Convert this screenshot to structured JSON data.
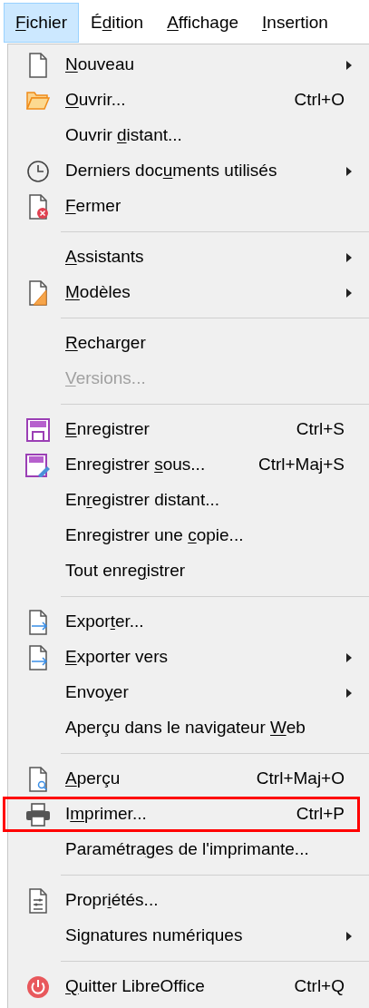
{
  "menubar": [
    {
      "key": "F",
      "after": "ichier",
      "selected": true
    },
    {
      "before": "É",
      "key": "d",
      "after": "ition",
      "selected": false
    },
    {
      "key": "A",
      "after": "ffichage",
      "selected": false
    },
    {
      "key": "I",
      "after": "nsertion",
      "selected": false
    }
  ],
  "menu": [
    {
      "kind": "item",
      "key": "N",
      "after": "ouveau",
      "submenu": true
    },
    {
      "kind": "item",
      "key": "O",
      "after": "uvrir...",
      "shortcut": "Ctrl+O"
    },
    {
      "kind": "item",
      "before": "Ouvrir ",
      "key": "d",
      "after": "istant..."
    },
    {
      "kind": "item",
      "before": "Derniers doc",
      "key": "u",
      "after": "ments utilisés",
      "submenu": true
    },
    {
      "kind": "item",
      "key": "F",
      "after": "ermer"
    },
    {
      "kind": "separator"
    },
    {
      "kind": "item",
      "key": "A",
      "after": "ssistants",
      "submenu": true
    },
    {
      "kind": "item",
      "key": "M",
      "after": "odèles",
      "submenu": true
    },
    {
      "kind": "separator"
    },
    {
      "kind": "item",
      "key": "R",
      "after": "echarger"
    },
    {
      "kind": "item",
      "key": "V",
      "after": "ersions...",
      "disabled": true
    },
    {
      "kind": "separator"
    },
    {
      "kind": "item",
      "key": "E",
      "after": "nregistrer",
      "shortcut": "Ctrl+S"
    },
    {
      "kind": "item",
      "before": "Enregistrer ",
      "key": "s",
      "after": "ous...",
      "shortcut": "Ctrl+Maj+S"
    },
    {
      "kind": "item",
      "before": "En",
      "key": "r",
      "after": "egistrer distant..."
    },
    {
      "kind": "item",
      "before": "Enregistrer une ",
      "key": "c",
      "after": "opie..."
    },
    {
      "kind": "item",
      "before": "Tout enre",
      "key": "g",
      "after": "istrer"
    },
    {
      "kind": "separator"
    },
    {
      "kind": "item",
      "before": "Expor",
      "key": "t",
      "after": "er..."
    },
    {
      "kind": "item",
      "key": "E",
      "after": "xporter vers",
      "submenu": true
    },
    {
      "kind": "item",
      "before": "Envo",
      "key": "y",
      "after": "er",
      "submenu": true
    },
    {
      "kind": "item",
      "before": "Aperçu dans le navigateur ",
      "key": "W",
      "after": "eb"
    },
    {
      "kind": "separator"
    },
    {
      "kind": "item",
      "key": "A",
      "after": "perçu",
      "shortcut": "Ctrl+Maj+O"
    },
    {
      "kind": "item",
      "before": "I",
      "key": "m",
      "after": "primer...",
      "shortcut": "Ctrl+P",
      "highlighted": true
    },
    {
      "kind": "item",
      "before": "Paramétra",
      "key": "g",
      "after": "es de l'imprimante..."
    },
    {
      "kind": "separator"
    },
    {
      "kind": "item",
      "before": "Propr",
      "key": "i",
      "after": "étés..."
    },
    {
      "kind": "item",
      "before": "Signatures numériques",
      "submenu": true
    },
    {
      "kind": "separator"
    },
    {
      "kind": "item",
      "key": "Q",
      "after": "uitter LibreOffice",
      "shortcut": "Ctrl+Q"
    }
  ]
}
